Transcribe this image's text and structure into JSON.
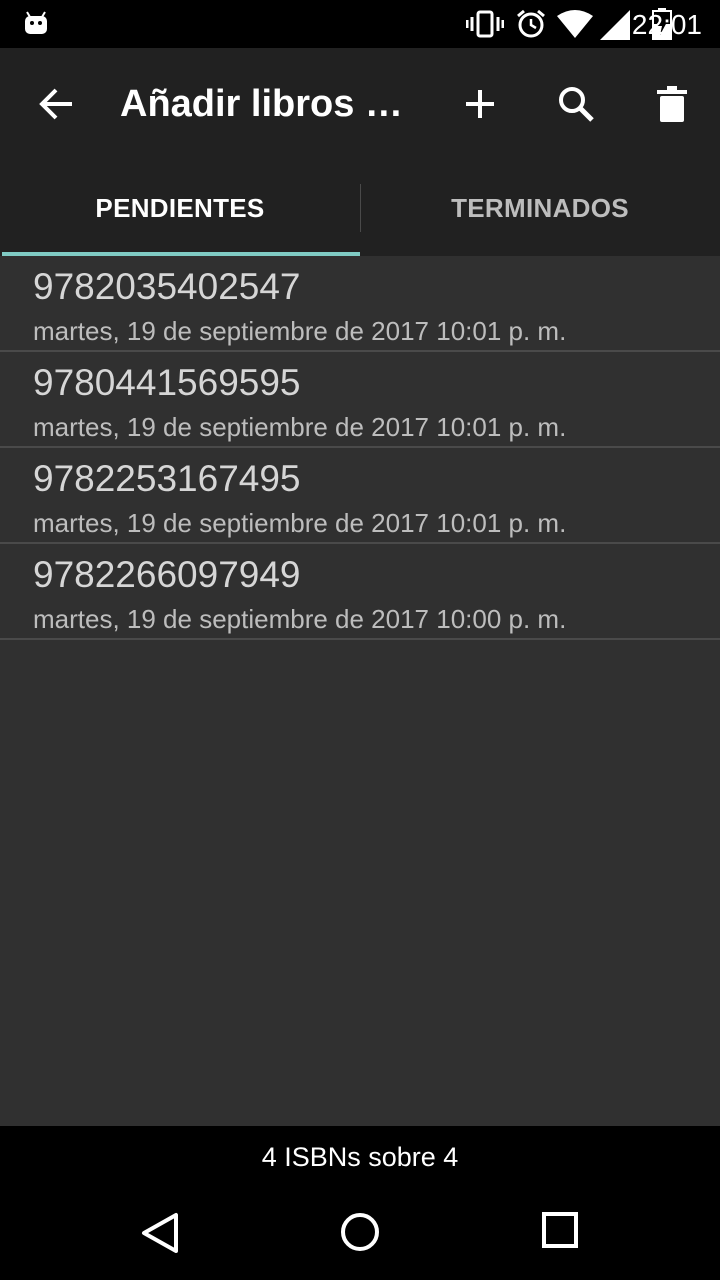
{
  "status_bar": {
    "time": "22:01",
    "icons": [
      "android-icon",
      "vibrate-icon",
      "alarm-icon",
      "wifi-icon",
      "signal-icon",
      "battery-charging-icon"
    ]
  },
  "app_bar": {
    "title": "Añadir libros e...",
    "actions": [
      "back-arrow-icon",
      "add-icon",
      "search-icon",
      "delete-icon"
    ]
  },
  "tabs": [
    {
      "label": "PENDIENTES",
      "active": true
    },
    {
      "label": "TERMINADOS",
      "active": false
    }
  ],
  "items": [
    {
      "isbn": "9782035402547",
      "date": "martes, 19 de septiembre de 2017 10:01 p. m."
    },
    {
      "isbn": "9780441569595",
      "date": "martes, 19 de septiembre de 2017 10:01 p. m."
    },
    {
      "isbn": "9782253167495",
      "date": "martes, 19 de septiembre de 2017 10:01 p. m."
    },
    {
      "isbn": "9782266097949",
      "date": "martes, 19 de septiembre de 2017 10:00 p. m."
    }
  ],
  "footer": {
    "summary": "4 ISBNs sobre 4"
  },
  "nav_bar": [
    "back-triangle-icon",
    "home-circle-icon",
    "recents-square-icon"
  ],
  "colors": {
    "accent": "#80cbc4",
    "app_bar": "#212121",
    "background": "#303030"
  }
}
